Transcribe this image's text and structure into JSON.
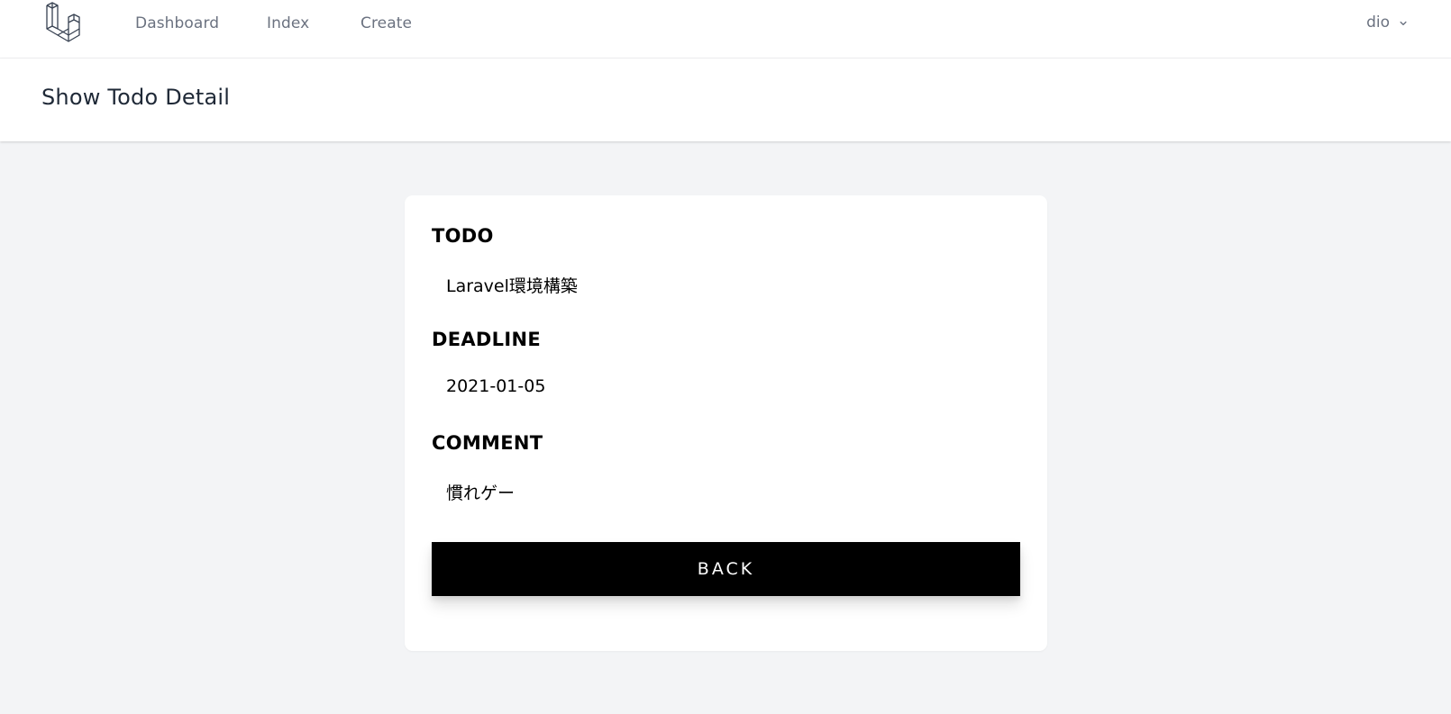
{
  "nav": {
    "links": [
      "Dashboard",
      "Index",
      "Create"
    ],
    "user_name": "dio"
  },
  "header": {
    "title": "Show Todo Detail"
  },
  "todo": {
    "todo_label": "TODO",
    "todo_value": "Laravel環境構築",
    "deadline_label": "DEADLINE",
    "deadline_value": "2021-01-05",
    "comment_label": "COMMENT",
    "comment_value": "慣れゲー",
    "back_label": "BACK"
  },
  "colors": {
    "nav_text": "#6b7280",
    "page_bg": "#f3f4f6",
    "button_bg": "#000000",
    "button_text": "#ffffff"
  },
  "icons": {
    "logo": "laravel-logo-icon",
    "user_dropdown": "chevron-down-icon"
  }
}
